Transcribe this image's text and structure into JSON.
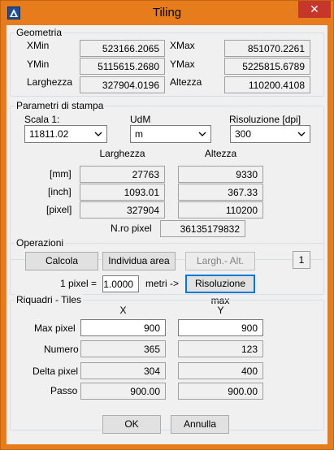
{
  "window": {
    "title": "Tiling",
    "close_glyph": "✕",
    "app_icon": "autocad-logo-icon"
  },
  "geometria": {
    "title": "Geometria",
    "xmin_label": "XMin",
    "xmin": "523166.2065",
    "xmax_label": "XMax",
    "xmax": "851070.2261",
    "ymin_label": "YMin",
    "ymin": "5115615.2680",
    "ymax_label": "YMax",
    "ymax": "5225815.6789",
    "larghezza_label": "Larghezza",
    "larghezza": "327904.0196",
    "altezza_label": "Altezza",
    "altezza": "110200.4108"
  },
  "stampa": {
    "title": "Parametri di stampa",
    "scala_label": "Scala 1:",
    "scala_value": "11811.02",
    "udm_label": "UdM",
    "udm_value": "m",
    "risoluzione_label": "Risoluzione [dpi]",
    "risoluzione_value": "300",
    "col_larghezza": "Larghezza",
    "col_altezza": "Altezza",
    "rows": [
      {
        "label": "[mm]",
        "w": "27763",
        "h": "9330"
      },
      {
        "label": "[inch]",
        "w": "1093.01",
        "h": "367.33"
      },
      {
        "label": "[pixel]",
        "w": "327904",
        "h": "110200"
      }
    ],
    "npixel_label": "N.ro pixel",
    "npixel_value": "36135179832"
  },
  "operazioni": {
    "title": "Operazioni",
    "calcola": "Calcola",
    "individua": "Individua area",
    "largh_alt": "Largh.- Alt.",
    "counter": "1",
    "pixel_label": "1 pixel =",
    "pixel_value": "1.0000",
    "metri_label": "metri ->",
    "risoluzione_max": "Risoluzione max"
  },
  "riquadri": {
    "title": "Riquadri - Tiles",
    "col_x": "X",
    "col_y": "Y",
    "rows": [
      {
        "label": "Max pixel",
        "x": "900",
        "y": "900"
      },
      {
        "label": "Numero",
        "x": "365",
        "y": "123"
      },
      {
        "label": "Delta pixel",
        "x": "304",
        "y": "400"
      },
      {
        "label": "Passo",
        "x": "900.00",
        "y": "900.00"
      }
    ]
  },
  "footer": {
    "ok": "OK",
    "annulla": "Annulla"
  }
}
